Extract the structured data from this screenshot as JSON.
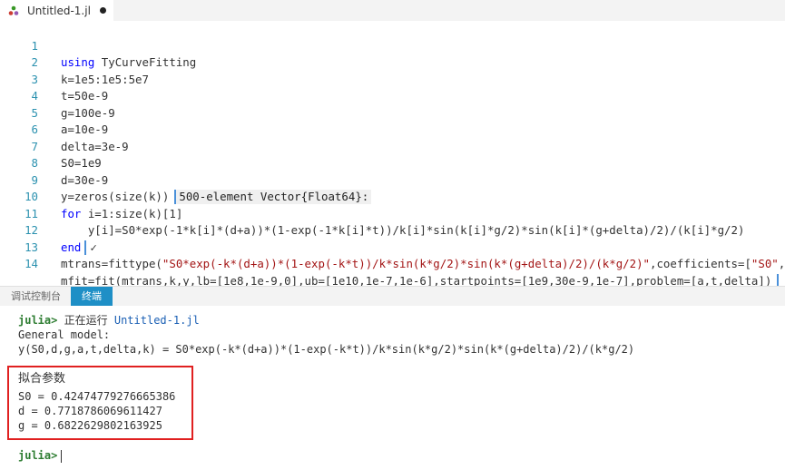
{
  "tab": {
    "title": "Untitled-1.jl"
  },
  "editor": {
    "lines": [
      {
        "num": "1",
        "text": "using TyCurveFitting"
      },
      {
        "num": "2",
        "text": "k=1e5:1e5:5e7"
      },
      {
        "num": "3",
        "text": "t=50e-9"
      },
      {
        "num": "4",
        "text": "g=100e-9"
      },
      {
        "num": "5",
        "text": "a=10e-9"
      },
      {
        "num": "6",
        "text": "delta=3e-9"
      },
      {
        "num": "7",
        "text": "S0=1e9"
      },
      {
        "num": "8",
        "text": "d=30e-9"
      },
      {
        "num": "9",
        "text": "y=zeros(size(k))",
        "inline": "500-element Vector{Float64}:"
      },
      {
        "num": "10",
        "text": "for i=1:size(k)[1]"
      },
      {
        "num": "11",
        "text": "    y[i]=S0*exp(-1*k[i]*(d+a))*(1-exp(-1*k[i]*t))/k[i]*sin(k[i]*g/2)*sin(k[i]*(g+delta)/2)/(k[i]*g/2)"
      },
      {
        "num": "12",
        "text": "end",
        "inline": "✓"
      },
      {
        "num": "13",
        "text": "mtrans=fittype(\"S0*exp(-k*(d+a))*(1-exp(-k*t))/k*sin(k*g/2)*sin(k*(g+delta)/2)/(k*g/2)\",coefficients=[\"S0\","
      },
      {
        "num": "14",
        "text": "mfit=fit(mtrans,k,y,lb=[1e8,1e-9,0],ub=[1e10,1e-7,1e-6],startpoints=[1e9,30e-9,1e-7],problem=[a,t,delta])"
      }
    ]
  },
  "panel": {
    "tab_debug": "调试控制台",
    "tab_terminal": "终端"
  },
  "terminal": {
    "prompt": "julia>",
    "running_text": "正在运行",
    "running_file": "Untitled-1.jl",
    "model_heading": "General model:",
    "model_formula": "y(S0,d,g,a,t,delta,k) = S0*exp(-k*(d+a))*(1-exp(-k*t))/k*sin(k*g/2)*sin(k*(g+delta)/2)/(k*g/2)",
    "params_title": "拟合参数",
    "param_s0": "S0 = 0.42474779276665386",
    "param_d": "d = 0.7718786069611427",
    "param_g": "g = 0.6822629802163925",
    "final_prompt": "julia>"
  }
}
